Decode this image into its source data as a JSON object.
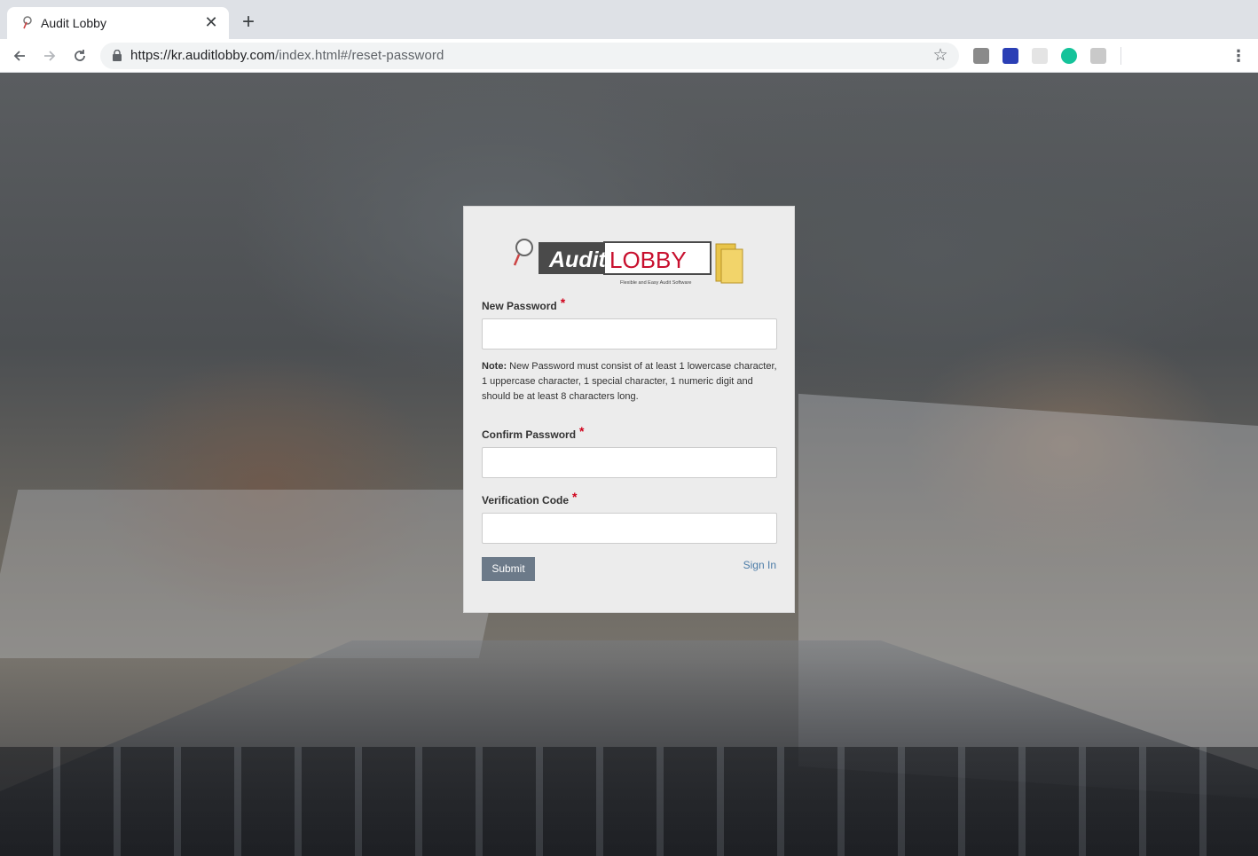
{
  "browser": {
    "tab_title": "Audit Lobby",
    "new_tab_symbol": "+",
    "close_symbol": "✕",
    "url_host": "https://kr.auditlobby.com",
    "url_path": "/index.html#/reset-password",
    "extensions": [
      "extension-icon",
      "extension-icon",
      "extension-icon",
      "grammarly-icon",
      "extension-icon"
    ]
  },
  "logo": {
    "word1": "Audit",
    "word2": "LOBBY",
    "tagline": "Flexible and Easy Audit Software"
  },
  "form": {
    "new_password_label": "New Password",
    "required_mark": "*",
    "note_prefix": "Note:",
    "note_text": " New Password must consist of at least 1 lowercase character, 1 uppercase character, 1 special character, 1 numeric digit and should be at least 8 characters long.",
    "confirm_password_label": "Confirm Password",
    "verification_code_label": "Verification Code",
    "new_password_value": "",
    "confirm_password_value": "",
    "verification_code_value": "",
    "submit_label": "Submit",
    "signin_label": "Sign In"
  },
  "colors": {
    "submit_bg": "#6c7a89",
    "link": "#4a7ba7",
    "required": "#d0021b",
    "brand_red": "#c8102e"
  }
}
